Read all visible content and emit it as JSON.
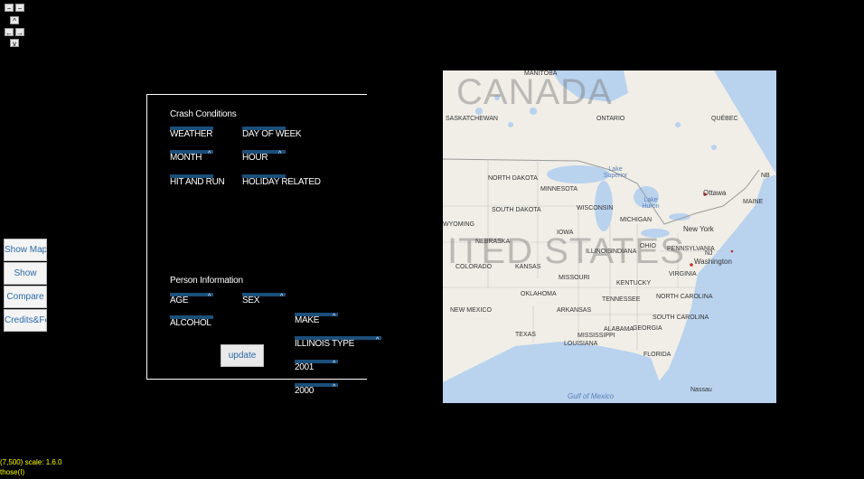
{
  "nav": {
    "minus": "−",
    "up": "^",
    "left": "←",
    "right": "→",
    "down": "v"
  },
  "sidebar": {
    "items": [
      {
        "label": "Show Map"
      },
      {
        "label": "Show"
      },
      {
        "label": "Compare"
      },
      {
        "label": "Credits&Fe"
      }
    ]
  },
  "crash": {
    "title": "Crash Conditions",
    "weather": "WEATHER",
    "day_of_week": "DAY OF WEEK",
    "month": "MONTH",
    "hour": "HOUR",
    "hit_and_run": "HIT AND RUN",
    "holiday_related": "HOLIDAY RELATED"
  },
  "person": {
    "title": "Person Information",
    "age": "AGE",
    "sex": "SEX",
    "alcohol": "ALCOHOL"
  },
  "vehicle": {
    "make": "MAKE",
    "illinois_type": "ILLINOIS TYPE",
    "year1": "2001",
    "year2": "2000"
  },
  "update_label": "update",
  "map": {
    "country_canada": "CANADA",
    "country_us": "ITED STATES",
    "labels": {
      "manitoba": "MANITOBA",
      "saskatchewan": "SASKATCHEWAN",
      "ontario": "ONTARIO",
      "quebec": "QUÉBEC",
      "nb": "NB",
      "north_dakota": "NORTH DAKOTA",
      "minnesota": "MINNESOTA",
      "lake_superior": "Lake Superior",
      "south_dakota": "SOUTH DAKOTA",
      "wisconsin": "WISCONSIN",
      "michigan": "MICHIGAN",
      "lake_huron": "Lake Huron",
      "ottawa": "Ottawa",
      "maine": "MAINE",
      "wyoming": "WYOMING",
      "nebraska": "NEBRASKA",
      "iowa": "IOWA",
      "illinois": "ILLINOIS",
      "indiana": "INDIANA",
      "ohio": "OHIO",
      "new_york": "New York",
      "pennsylvania": "PENNSYLVANIA",
      "nj": "NJ",
      "washington": "Washington",
      "colorado": "COLORADO",
      "kansas": "KANSAS",
      "missouri": "MISSOURI",
      "kentucky": "KENTUCKY",
      "virginia": "VIRGINIA",
      "oklahoma": "OKLAHOMA",
      "tennessee": "TENNESSEE",
      "north_carolina": "NORTH CAROLINA",
      "new_mexico": "NEW MEXICO",
      "arkansas": "ARKANSAS",
      "south_carolina": "SOUTH CAROLINA",
      "texas": "TEXAS",
      "mississippi": "MISSISSIPPI",
      "alabama": "ALABAMA",
      "georgia": "GEORGIA",
      "louisiana": "LOUISIANA",
      "florida": "FLORIDA",
      "gulf": "Gulf of Mexico",
      "nassau": "Nassau"
    }
  },
  "status": {
    "line1": "(7,500) scale: 1.6.0",
    "line2": "those(I)"
  },
  "colors": {
    "dropdown_bar": "#1b4f7a",
    "link_text": "#2a6aa8",
    "status_text": "#ffff00"
  }
}
